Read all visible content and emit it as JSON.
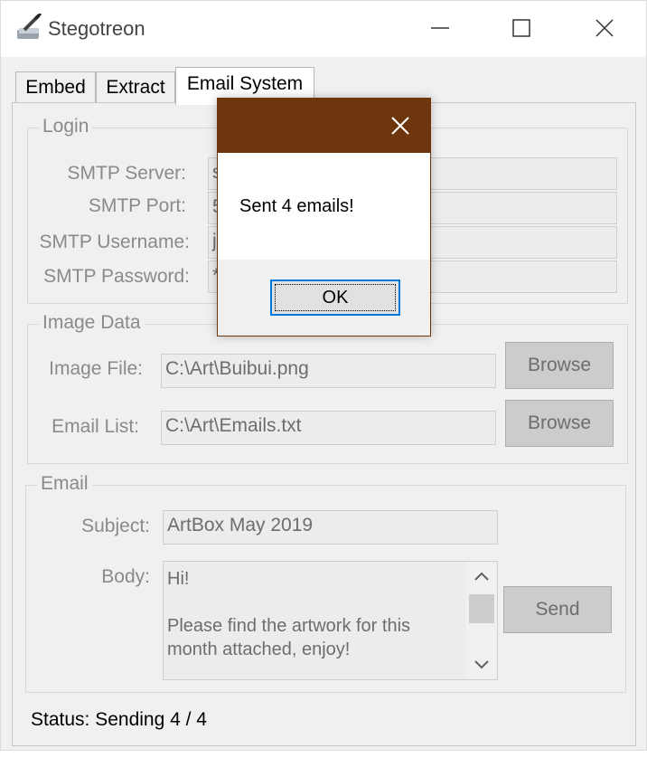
{
  "window": {
    "title": "Stegotreon",
    "app_icon": "pen-icon",
    "controls": [
      "minimize-icon",
      "maximize-icon",
      "close-icon"
    ]
  },
  "tabs": [
    {
      "label": "Embed",
      "active": false
    },
    {
      "label": "Extract",
      "active": false
    },
    {
      "label": "Email System",
      "active": true
    }
  ],
  "login": {
    "group_label": "Login",
    "smtp_server_label": "SMTP Server:",
    "smtp_server_value": "s",
    "smtp_port_label": "SMTP Port:",
    "smtp_port_value": "5",
    "smtp_username_label": "SMTP Username:",
    "smtp_username_value": "jc",
    "smtp_password_label": "SMTP Password:",
    "smtp_password_value": "*"
  },
  "image_data": {
    "group_label": "Image Data",
    "image_file_label": "Image File:",
    "image_file_value": "C:\\Art\\Buibui.png",
    "email_list_label": "Email List:",
    "email_list_value": "C:\\Art\\Emails.txt",
    "browse_label": "Browse"
  },
  "email": {
    "group_label": "Email",
    "subject_label": "Subject:",
    "subject_value": "ArtBox May 2019",
    "body_label": "Body:",
    "body_value": "Hi!\n\nPlease find the artwork for this month attached, enjoy!",
    "send_label": "Send"
  },
  "status": {
    "text": "Status: Sending 4 / 4"
  },
  "dialog": {
    "message": "Sent 4 emails!",
    "ok_label": "OK",
    "title_color": "#6e360c"
  }
}
